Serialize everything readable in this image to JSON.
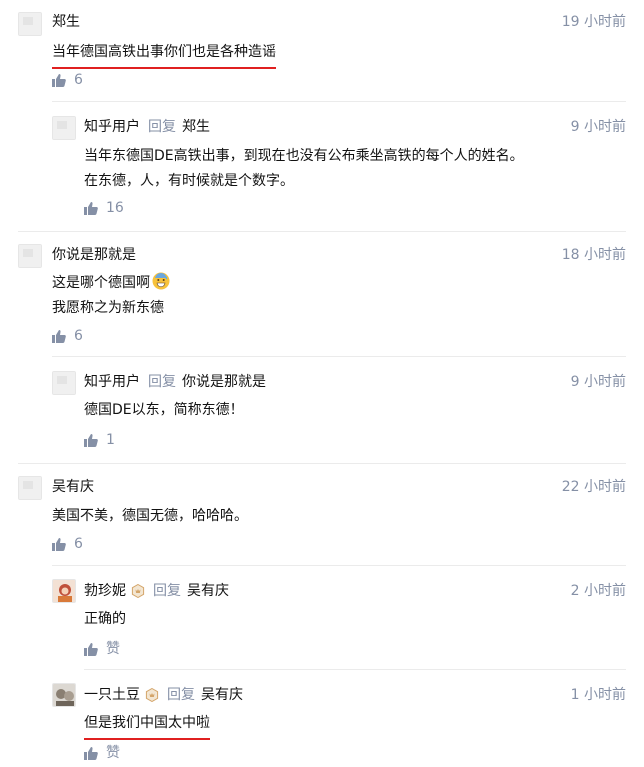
{
  "unit_hours_ago": "小时前",
  "reply_word": "回复",
  "threads": [
    {
      "author": "郑生",
      "time": "19 小时前",
      "lines": [
        "当年德国高铁出事你们也是各种造谣"
      ],
      "likes": "6",
      "replies": [
        {
          "author": "知乎用户",
          "reply_to": "郑生",
          "time": "9 小时前",
          "lines": [
            "当年东德国DE高铁出事，到现在也没有公布乘坐高铁的每个人的姓名。",
            "在东德，人，有时候就是个数字。"
          ],
          "likes": "16"
        }
      ]
    },
    {
      "author": "你说是那就是",
      "time": "18 小时前",
      "lines": [
        "这是哪个德国啊",
        "我愿称之为新东德"
      ],
      "likes": "6",
      "replies": [
        {
          "author": "知乎用户",
          "reply_to": "你说是那就是",
          "time": "9 小时前",
          "lines": [
            "德国DE以东，简称东德！"
          ],
          "likes": "1"
        }
      ]
    },
    {
      "author": "吴有庆",
      "time": "22 小时前",
      "lines": [
        "美国不美，德国无德，哈哈哈。"
      ],
      "likes": "6",
      "replies": [
        {
          "author": "勃珍妮",
          "reply_to": "吴有庆",
          "time": "2 小时前",
          "lines": [
            "正确的"
          ],
          "likes": "赞"
        },
        {
          "author": "一只土豆",
          "reply_to": "吴有庆",
          "time": "1 小时前",
          "lines": [
            "但是我们中国太中啦"
          ],
          "likes": "赞"
        }
      ]
    }
  ],
  "colors": {
    "meta": "#8590a6",
    "text": "#121212",
    "underline": "#e02020",
    "divider": "#ebebeb",
    "badge": "#d4a56a"
  },
  "icons": [
    "thumbs-up-icon",
    "avatar-placeholder-icon",
    "grinning-sweat-emoji",
    "level-badge-icon"
  ]
}
